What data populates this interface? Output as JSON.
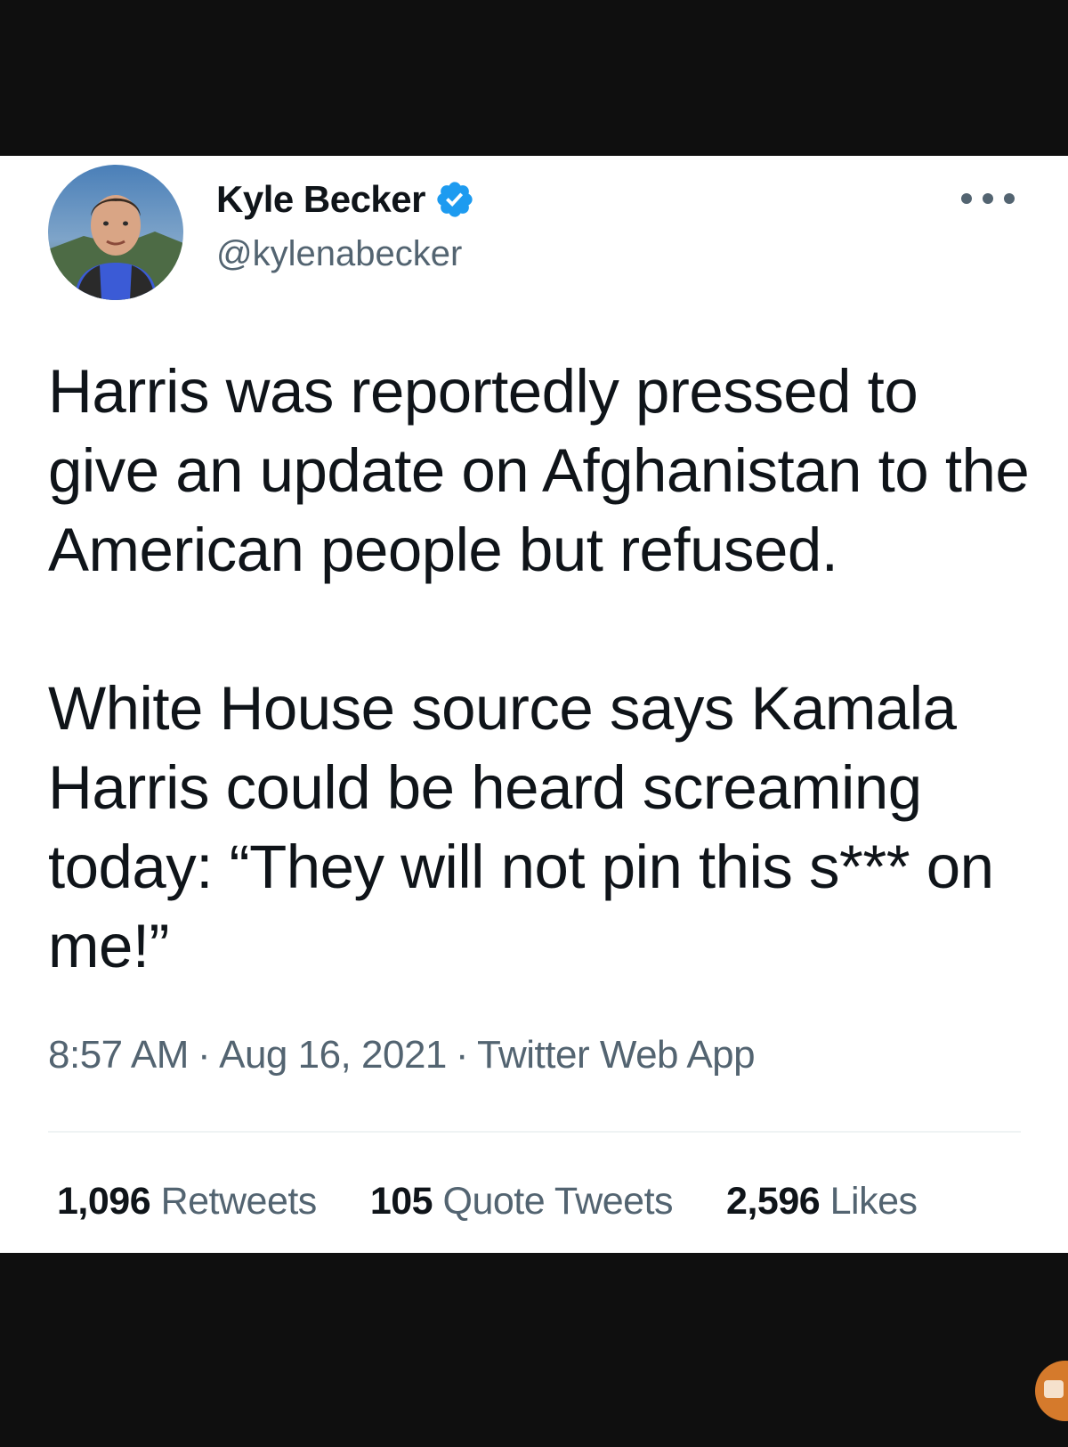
{
  "tweet": {
    "author": {
      "display_name": "Kyle Becker",
      "handle": "@kylenabecker",
      "verified": true
    },
    "text_paragraphs": [
      "Harris was reportedly pressed to give an update on Afghanistan to the American people but refused.",
      "White House source says Kamala Harris could be heard screaming today: “They will not pin this s*** on me!”"
    ],
    "timestamp": {
      "time": "8:57 AM",
      "date": "Aug 16, 2021",
      "source": "Twitter Web App",
      "separator": "·"
    },
    "stats": {
      "retweets": {
        "count": "1,096",
        "label": "Retweets"
      },
      "quote_tweets": {
        "count": "105",
        "label": "Quote Tweets"
      },
      "likes": {
        "count": "2,596",
        "label": "Likes"
      }
    }
  },
  "icons": {
    "verified": "verified-badge-icon",
    "more": "more-options-icon"
  },
  "colors": {
    "background_dark": "#0f0f0f",
    "card": "#ffffff",
    "text_primary": "#0f1419",
    "text_secondary": "#536471",
    "verified_blue": "#1d9bf0",
    "divider": "#eff3f4"
  }
}
